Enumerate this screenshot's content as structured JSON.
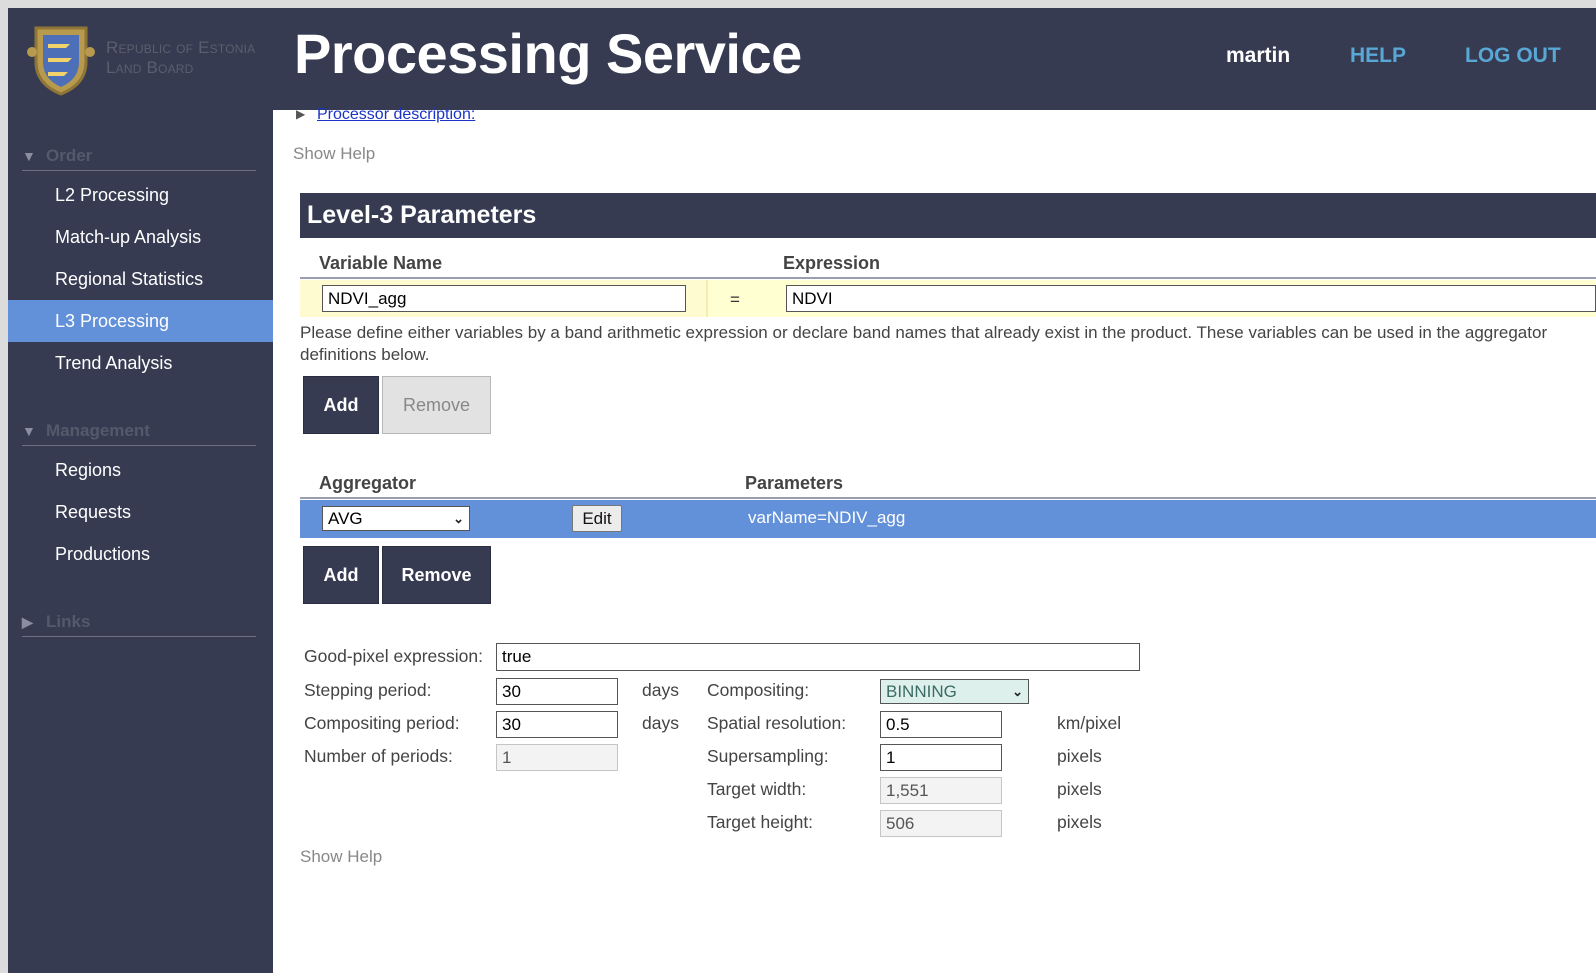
{
  "header": {
    "brand_line1": "Republic of Estonia",
    "brand_line2": "Land Board",
    "title": "Processing Service",
    "user": "martin",
    "help": "HELP",
    "logout": "LOG OUT"
  },
  "sidebar": {
    "order_section": "Order",
    "order_items": [
      "L2 Processing",
      "Match-up Analysis",
      "Regional Statistics",
      "L3 Processing",
      "Trend Analysis"
    ],
    "active_item": "L3 Processing",
    "management_section": "Management",
    "management_items": [
      "Regions",
      "Requests",
      "Productions"
    ],
    "links_section": "Links"
  },
  "main": {
    "processor_description": "Processor description:",
    "show_help_top": "Show Help",
    "panel_title": "Level-3 Parameters",
    "variables": {
      "col_name": "Variable Name",
      "col_expression": "Expression",
      "name_value": "NDVI_agg",
      "equals": "=",
      "expression_value": "NDVI",
      "note": "Please define either variables by a band arithmetic expression or declare band names that already exist in the product. These variables can be used in the aggregator definitions below.",
      "add": "Add",
      "remove": "Remove"
    },
    "aggregators": {
      "col_aggregator": "Aggregator",
      "col_parameters": "Parameters",
      "aggregator_value": "AVG",
      "edit": "Edit",
      "parameters_value": "varName=NDIV_agg",
      "add": "Add",
      "remove": "Remove"
    },
    "form": {
      "good_pixel_label": "Good-pixel expression:",
      "good_pixel_value": "true",
      "stepping_label": "Stepping period:",
      "stepping_value": "30",
      "compositing_period_label": "Compositing period:",
      "compositing_period_value": "30",
      "days": "days",
      "num_periods_label": "Number of periods:",
      "num_periods_value": "1",
      "compositing_label": "Compositing:",
      "compositing_value": "BINNING",
      "spatial_label": "Spatial resolution:",
      "spatial_value": "0.5",
      "spatial_unit": "km/pixel",
      "supersampling_label": "Supersampling:",
      "supersampling_value": "1",
      "target_width_label": "Target width:",
      "target_width_value": "1,551",
      "target_height_label": "Target height:",
      "target_height_value": "506",
      "pixels": "pixels"
    },
    "show_help_bottom": "Show Help"
  },
  "colors": {
    "header_bg": "#363b51",
    "accent": "#6290d9",
    "link": "#58a7d5"
  }
}
